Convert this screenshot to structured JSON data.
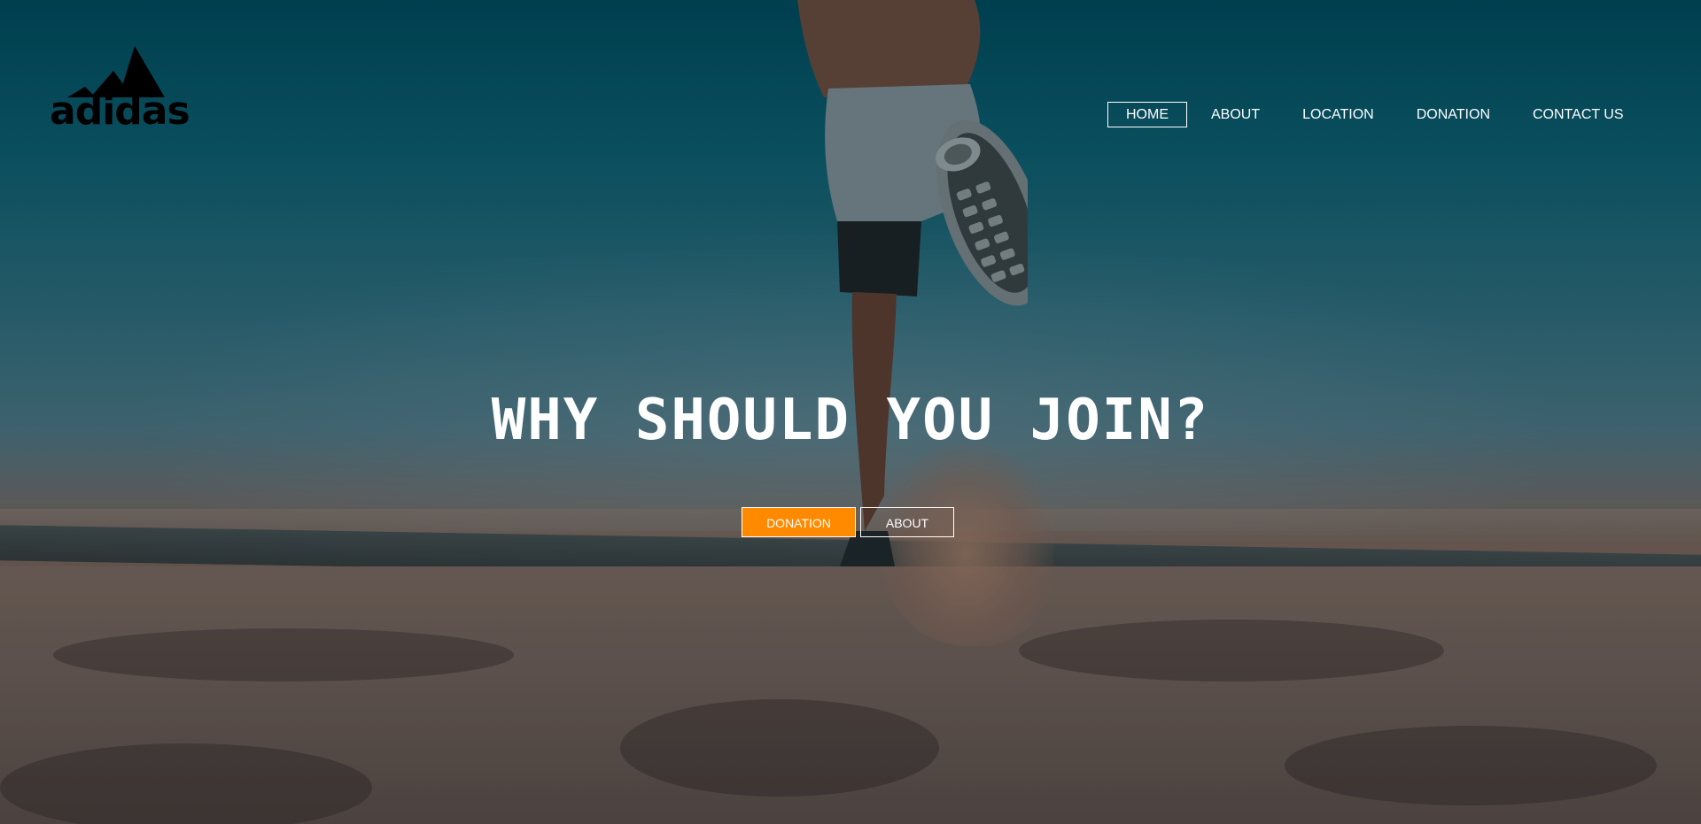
{
  "brand": {
    "logo_text": "adidas",
    "logo_icon": "adidas-performance-logo"
  },
  "nav": {
    "items": [
      {
        "label": "HOME",
        "active": true
      },
      {
        "label": "ABOUT",
        "active": false
      },
      {
        "label": "LOCATION",
        "active": false
      },
      {
        "label": "DONATION",
        "active": false
      },
      {
        "label": "CONTACT US",
        "active": false
      }
    ]
  },
  "hero": {
    "headline": "WHY SHOULD YOU JOIN?",
    "primary_button": "DONATION",
    "secondary_button": "ABOUT",
    "background_image": "runner-kicking-sand-on-desert-road"
  },
  "colors": {
    "accent": "#ff8a00",
    "text": "#ffffff",
    "sky": "#00485a"
  }
}
